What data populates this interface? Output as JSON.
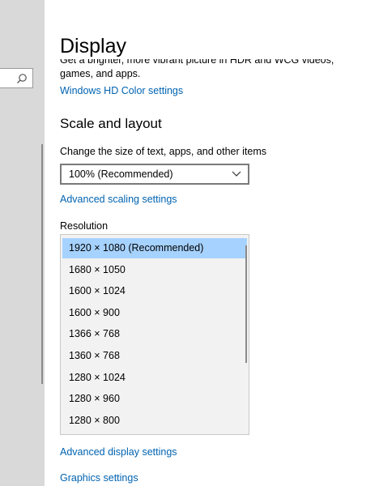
{
  "window": {
    "page_title": "Display"
  },
  "sidebar": {
    "search_placeholder": ""
  },
  "color": {
    "description": "Get a brighter, more vibrant picture in HDR and WCG videos, games, and apps.",
    "hd_color_link": "Windows HD Color settings"
  },
  "scale_layout": {
    "title": "Scale and layout",
    "size_label": "Change the size of text, apps, and other items",
    "size_value": "100% (Recommended)",
    "advanced_scaling_link": "Advanced scaling settings",
    "resolution_label": "Resolution",
    "resolutions": [
      {
        "label": "1920 × 1080 (Recommended)",
        "selected": true
      },
      {
        "label": "1680 × 1050",
        "selected": false
      },
      {
        "label": "1600 × 1024",
        "selected": false
      },
      {
        "label": "1600 × 900",
        "selected": false
      },
      {
        "label": "1366 × 768",
        "selected": false
      },
      {
        "label": "1360 × 768",
        "selected": false
      },
      {
        "label": "1280 × 1024",
        "selected": false
      },
      {
        "label": "1280 × 960",
        "selected": false
      },
      {
        "label": "1280 × 800",
        "selected": false
      }
    ]
  },
  "links": {
    "advanced_display": "Advanced display settings",
    "graphics": "Graphics settings"
  },
  "colors": {
    "link": "#0063b1",
    "selection": "#a6d2ff",
    "sidebar_bg": "#d9d9d9",
    "list_bg": "#f2f2f2"
  }
}
